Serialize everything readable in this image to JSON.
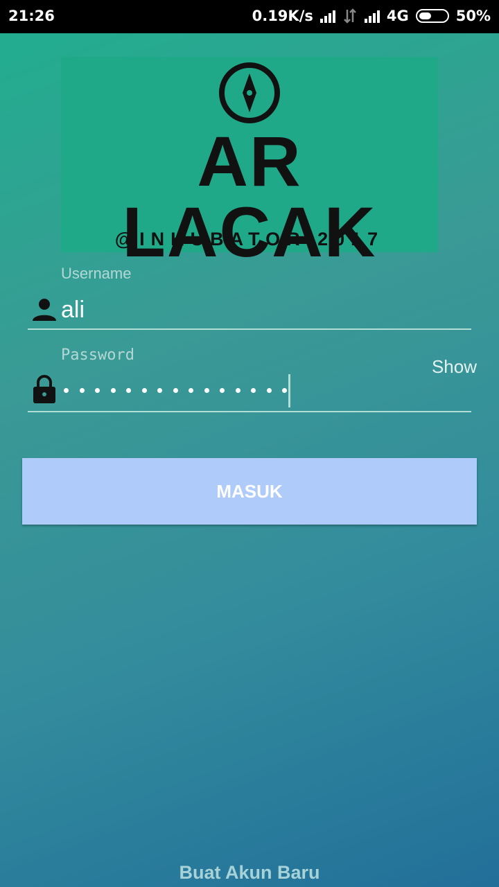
{
  "status_bar": {
    "time": "21:26",
    "network_speed": "0.19K/s",
    "network_type": "4G",
    "battery": "50%",
    "battery_level": 0.5,
    "icons": [
      "signal-icon",
      "data-arrows-icon",
      "signal-icon",
      "battery-icon"
    ]
  },
  "logo": {
    "title": "AR LACAK",
    "subtitle": "@INKUBATOR 2017",
    "icon": "compass-icon"
  },
  "form": {
    "username_label": "Username",
    "username_value": "ali",
    "password_label": "Password",
    "password_length": 15,
    "show_label": "Show",
    "submit_label": "MASUK"
  },
  "footer": {
    "register_link": "Buat  Akun Baru"
  },
  "colors": {
    "gradient_top": "#22ad8f",
    "gradient_bottom": "#226f9a",
    "button": "#aecbfa",
    "logo_bg": "#20a988"
  }
}
